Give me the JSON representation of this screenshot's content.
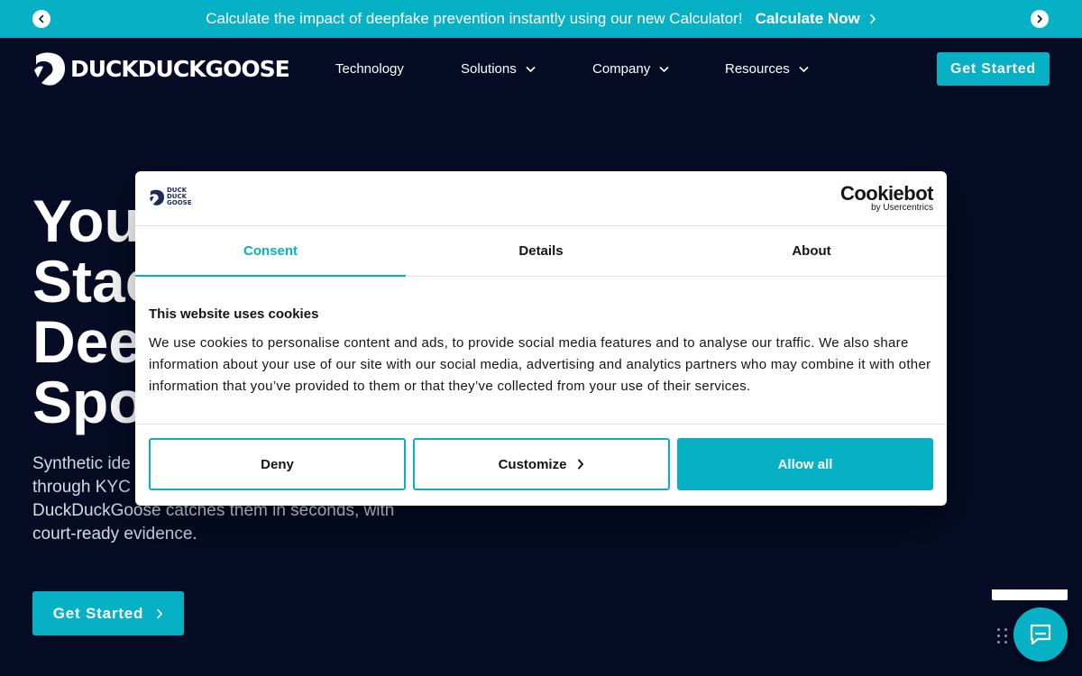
{
  "announcement": {
    "message": "Calculate the impact of deepfake prevention instantly using our new Calculator!",
    "cta_label": "Calculate Now"
  },
  "nav": {
    "logo_text_1": "DUCKDUCK",
    "logo_text_2": "GOOSE",
    "items": [
      {
        "label": "Technology"
      },
      {
        "label": "Solutions"
      },
      {
        "label": "Company"
      },
      {
        "label": "Resources"
      }
    ],
    "cta_label": "Get Started"
  },
  "hero": {
    "title_lines": [
      "You",
      "Stac",
      "Dee",
      "Spo"
    ],
    "subtitle_lines": [
      "Synthetic ide",
      "through KYC",
      "DuckDuckGoose catches them in seconds, with",
      "court-ready evidence."
    ],
    "cta_label": "Get Started"
  },
  "cookie_modal": {
    "logo_text": [
      "DUCK",
      "DUCK",
      "GOOSE"
    ],
    "brand_title": "Cookiebot",
    "brand_sub": "by Usercentrics",
    "tabs": [
      {
        "label": "Consent",
        "active": true
      },
      {
        "label": "Details",
        "active": false
      },
      {
        "label": "About",
        "active": false
      }
    ],
    "heading": "This website uses cookies",
    "body": "We use cookies to personalise content and ads, to provide social media features and to analyse our traffic. We also share information about your use of our site with our social media, advertising and analytics partners who may combine it with other information that you’ve provided to them or that they’ve collected from your use of their services.",
    "deny_label": "Deny",
    "customize_label": "Customize",
    "allow_label": "Allow all"
  },
  "colors": {
    "accent": "#07b1c5",
    "background": "#050c24"
  },
  "icons": {
    "prev": "chevron-left-icon",
    "next": "chevron-right-icon",
    "dropdown": "chevron-down-icon",
    "chat": "chat-bubble-icon"
  }
}
